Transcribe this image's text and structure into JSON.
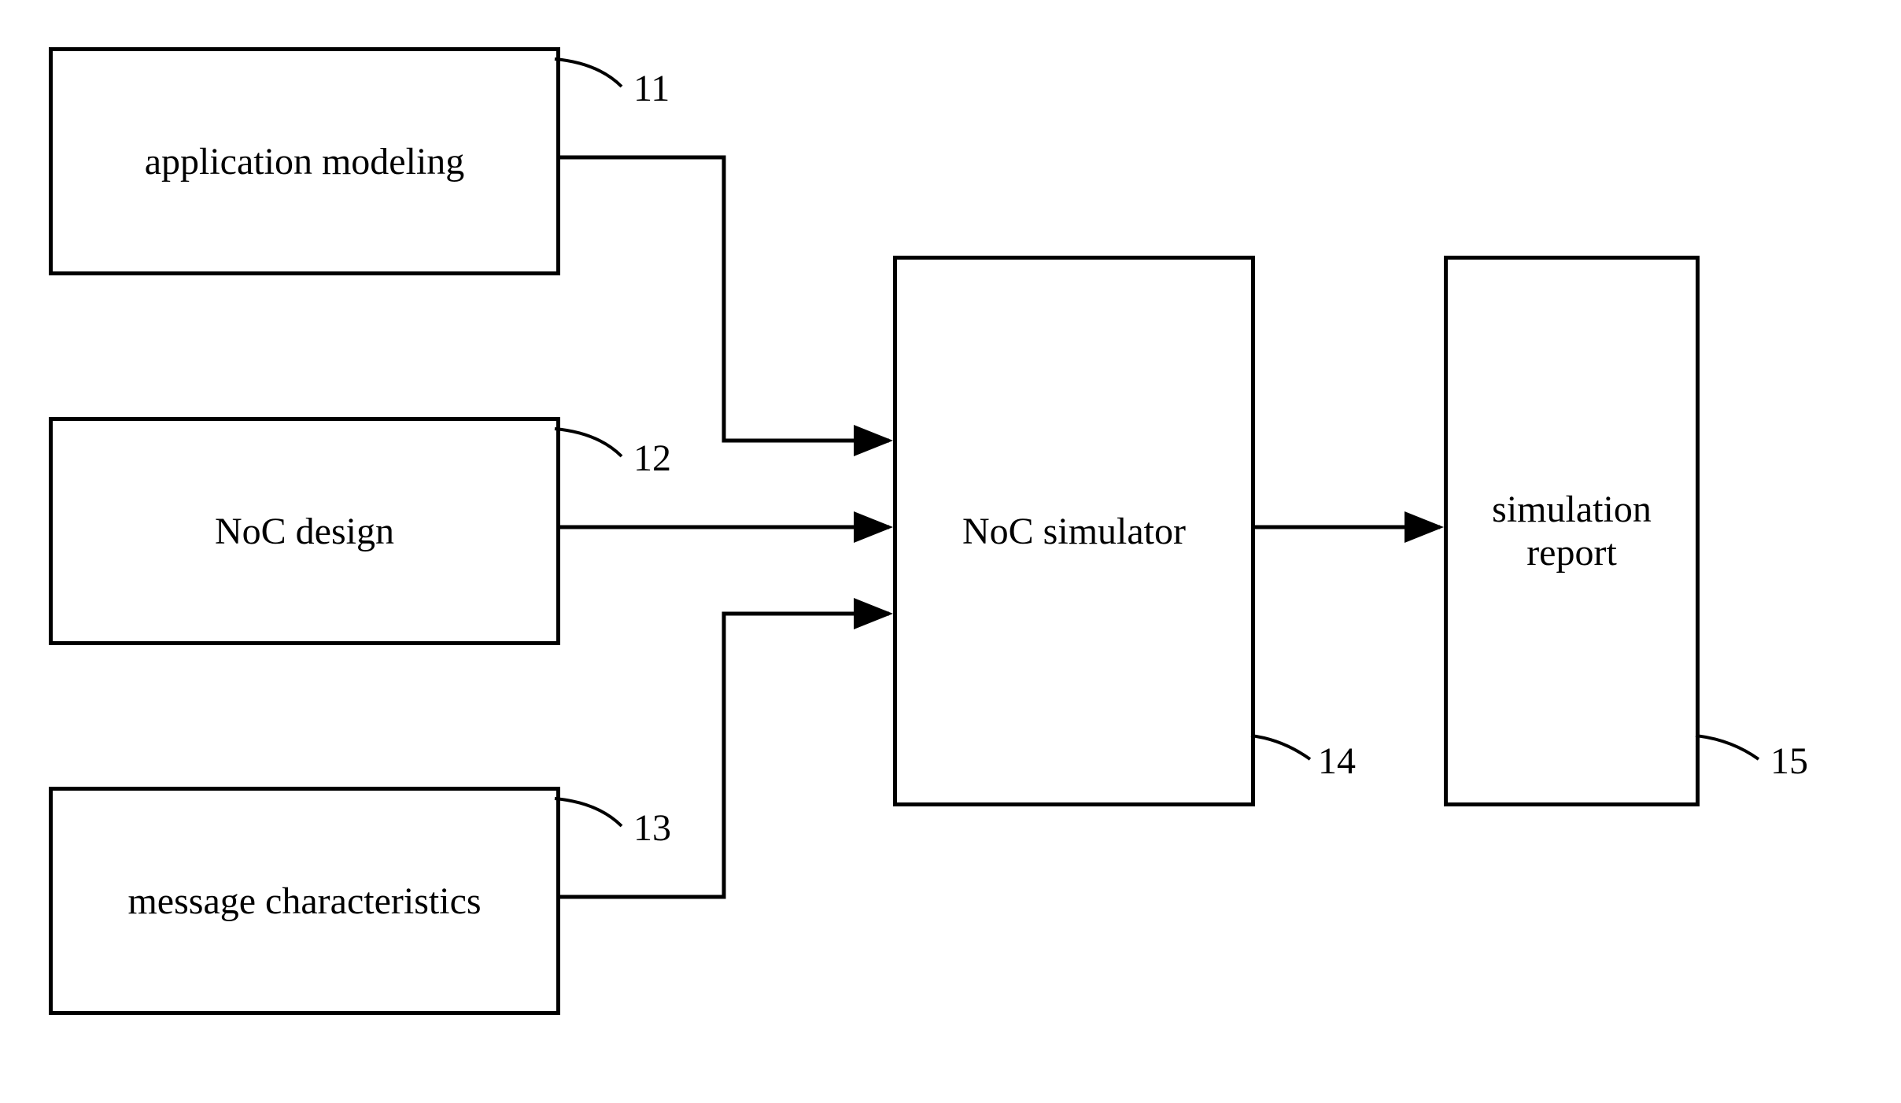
{
  "boxes": {
    "app_modeling": "application modeling",
    "noc_design": "NoC design",
    "msg_chars": "message characteristics",
    "noc_sim": "NoC simulator",
    "sim_report": "simulation\nreport"
  },
  "labels": {
    "l11": "11",
    "l12": "12",
    "l13": "13",
    "l14": "14",
    "l15": "15"
  }
}
